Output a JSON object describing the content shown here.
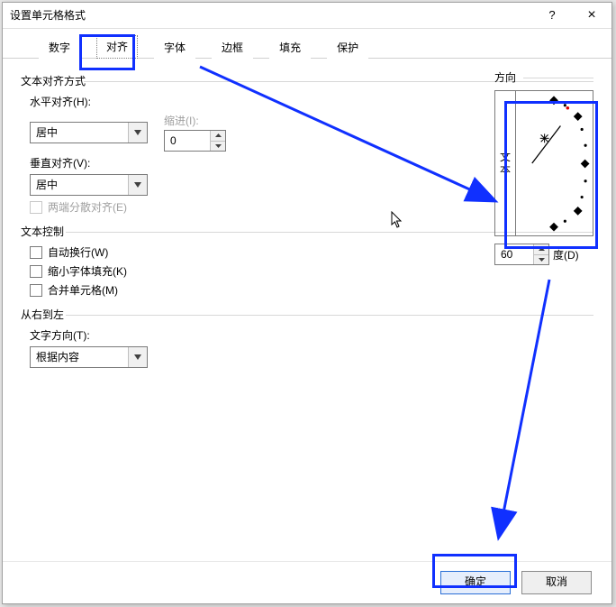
{
  "dialog": {
    "title": "设置单元格格式"
  },
  "tabs": {
    "number": "数字",
    "align": "对齐",
    "font": "字体",
    "border": "边框",
    "fill": "填充",
    "protect": "保护",
    "selected": "align"
  },
  "alignment": {
    "section_title": "文本对齐方式",
    "horizontal_label": "水平对齐(H):",
    "horizontal_value": "居中",
    "indent_label": "缩进(I):",
    "indent_value": "0",
    "vertical_label": "垂直对齐(V):",
    "vertical_value": "居中",
    "justify_label": "两端分散对齐(E)"
  },
  "text_control": {
    "section_title": "文本控制",
    "wrap": "自动换行(W)",
    "shrink": "缩小字体填充(K)",
    "merge": "合并单元格(M)"
  },
  "rtl": {
    "section_title": "从右到左",
    "dir_label": "文字方向(T):",
    "dir_value": "根据内容"
  },
  "orientation": {
    "section_title": "方向",
    "vertical_text": "文本",
    "degrees_value": "60",
    "degrees_label": "度(D)"
  },
  "buttons": {
    "ok": "确定",
    "cancel": "取消"
  },
  "titlebar": {
    "help": "?",
    "close": "×"
  }
}
